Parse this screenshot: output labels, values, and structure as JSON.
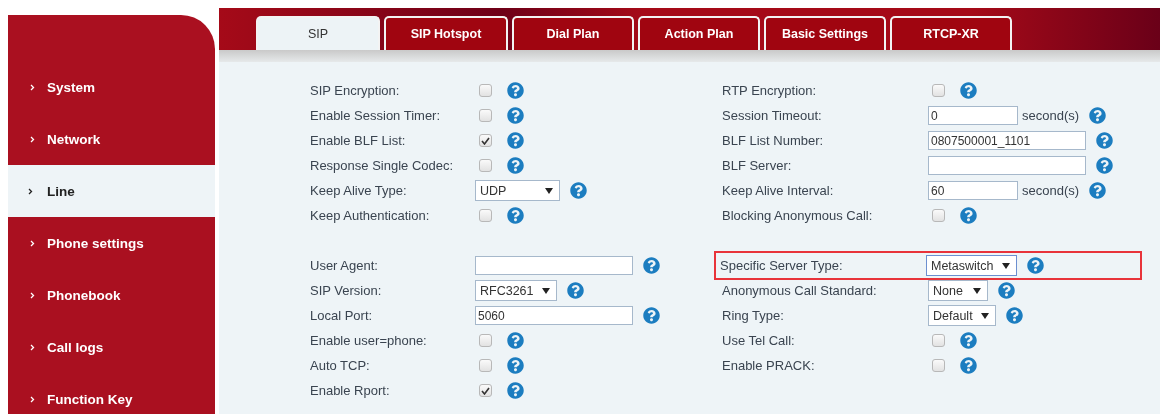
{
  "sidebar": {
    "items": [
      {
        "label": "System",
        "selected": false
      },
      {
        "label": "Network",
        "selected": false
      },
      {
        "label": "Line",
        "selected": true
      },
      {
        "label": "Phone settings",
        "selected": false
      },
      {
        "label": "Phonebook",
        "selected": false
      },
      {
        "label": "Call logs",
        "selected": false
      },
      {
        "label": "Function Key",
        "selected": false
      }
    ]
  },
  "tabs": [
    {
      "label": "SIP",
      "selected": true
    },
    {
      "label": "SIP Hotspot",
      "selected": false
    },
    {
      "label": "Dial Plan",
      "selected": false
    },
    {
      "label": "Action Plan",
      "selected": false
    },
    {
      "label": "Basic Settings",
      "selected": false
    },
    {
      "label": "RTCP-XR",
      "selected": false
    }
  ],
  "sections": [
    {
      "left": [
        {
          "label": "SIP Encryption:",
          "kind": "checkbox",
          "checked": false
        },
        {
          "label": "Enable Session Timer:",
          "kind": "checkbox",
          "checked": false
        },
        {
          "label": "Enable BLF List:",
          "kind": "checkbox",
          "checked": true
        },
        {
          "label": "Response Single Codec:",
          "kind": "checkbox",
          "checked": false
        },
        {
          "label": "Keep Alive Type:",
          "kind": "select",
          "value": "UDP"
        },
        {
          "label": "Keep Authentication:",
          "kind": "checkbox",
          "checked": false
        }
      ],
      "right": [
        {
          "label": "RTP Encryption:",
          "kind": "checkbox",
          "checked": false
        },
        {
          "label": "Session Timeout:",
          "kind": "text",
          "value": "0",
          "unit": "second(s)"
        },
        {
          "label": "BLF List Number:",
          "kind": "text",
          "value": "0807500001_1101"
        },
        {
          "label": "BLF Server:",
          "kind": "text"
        },
        {
          "label": "Keep Alive Interval:",
          "kind": "text",
          "value": "60",
          "unit": "second(s)"
        },
        {
          "label": "Blocking Anonymous Call:",
          "kind": "checkbox",
          "checked": false
        }
      ]
    },
    {
      "left": [
        {
          "label": "User Agent:",
          "kind": "text"
        },
        {
          "label": "SIP Version:",
          "kind": "select",
          "value": "RFC3261"
        },
        {
          "label": "Local Port:",
          "kind": "text",
          "value": "5060"
        },
        {
          "label": "Enable user=phone:",
          "kind": "checkbox",
          "checked": false
        },
        {
          "label": "Auto TCP:",
          "kind": "checkbox",
          "checked": false
        },
        {
          "label": "Enable Rport:",
          "kind": "checkbox",
          "checked": true
        }
      ],
      "right": [
        {
          "label": "Specific Server Type:",
          "kind": "select",
          "value": "Metaswitch",
          "highlighted": true
        },
        {
          "label": "Anonymous Call Standard:",
          "kind": "select",
          "value": "None"
        },
        {
          "label": "Ring Type:",
          "kind": "select",
          "value": "Default"
        },
        {
          "label": "Use Tel Call:",
          "kind": "checkbox",
          "checked": false
        },
        {
          "label": "Enable PRACK:",
          "kind": "checkbox",
          "checked": false
        }
      ]
    }
  ]
}
